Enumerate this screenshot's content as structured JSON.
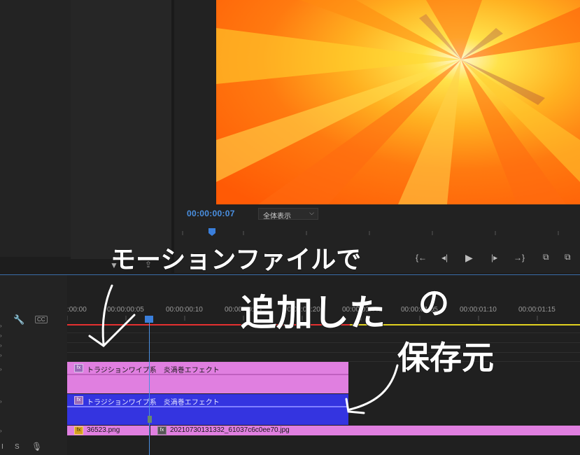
{
  "monitor": {
    "timecode": "00:00:00:07",
    "fit_option": "全体表示"
  },
  "timeline": {
    "ruler_labels": [
      ":00:00",
      "00:00:00:05",
      "00:00:00:10",
      "00:00:00:15",
      "00:00:00:20",
      "00:00:01:00",
      "00:00:01:05",
      "00:00:01:10",
      "00:00:01:15"
    ],
    "clips": {
      "v2": {
        "label": "トラジションワイプ系　炎渦巻エフェクト",
        "fx": "fx"
      },
      "v1": {
        "label": "トラジションワイプ系　炎渦巻エフェクト",
        "fx": "fx"
      },
      "png": {
        "label": "36523.png",
        "fx": "fx"
      },
      "jpg": {
        "label": "20210730131332_61037c6c0ee70.jpg",
        "fx": "fx"
      }
    },
    "header_labels": {
      "s": "S",
      "cc": "CC"
    }
  },
  "annotations": {
    "line1": "モーションファイルで",
    "line2": "追加した",
    "line2b": "の",
    "line3": "保存元"
  },
  "colors": {
    "accent_blue": "#4a90e2",
    "clip_pink": "#e07fe0",
    "clip_blue": "#3434e0",
    "work_red": "#e53030",
    "work_yellow": "#e0d020"
  }
}
